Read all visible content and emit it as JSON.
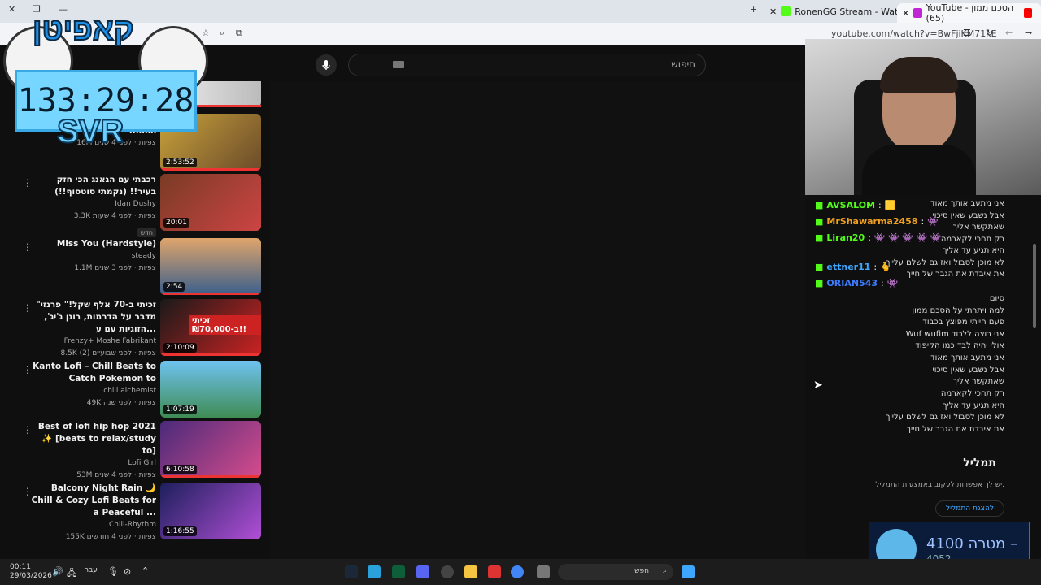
{
  "browser": {
    "tabs": [
      {
        "label": "RonenGG Stream - Watch Live",
        "color": "#53fc18"
      },
      {
        "label": "YouTube - הסכם ממון (65)",
        "color": "#ff0000"
      }
    ],
    "url": "youtube.com/watch?v=BwFjiKM71kE"
  },
  "youtube": {
    "search_placeholder": "חיפוש"
  },
  "overlay": {
    "logo": "קאפיטן",
    "timer": "133:29:28",
    "tag": "SVR"
  },
  "sidebar": {
    "items": [
      {
        "title": "",
        "channel": "",
        "meta": "16M צפיות · לפני 4 שנים",
        "duration": "2:53:52",
        "colors": [
          "#c8a33b",
          "#6b4a2a"
        ],
        "partial_title": "...mix"
      },
      {
        "title": "רכבתי עם הגאנג הכי חזק בעיר!! (נקמתי סוטסוף!!)",
        "channel": "Idan Dushy",
        "meta": "3.3K צפיות · לפני 4 שעות",
        "badge": "חדש",
        "duration": "20:01",
        "colors": [
          "#7a3b24",
          "#c44"
        ]
      },
      {
        "title": "Miss You (Hardstyle)",
        "channel": "steady",
        "meta": "1.1M צפיות · לפני 3 שנים",
        "duration": "2:54",
        "colors": [
          "#e0a56b",
          "#3a5f8c"
        ]
      },
      {
        "title": "\"זכיתי ב-70 אלף שקל!\" פרנזי מדבר על הדרמות, רונן ג'יג', הזוגיות עם ע...",
        "channel": "Frenzy+ Moshe Fabrikant",
        "meta": "8.5K צפיות · לפני שבועיים (2)",
        "duration": "2:10:09",
        "thumb_text": "זכיתי ב-₪70,000!!",
        "colors": [
          "#1a1a1a",
          "#c22"
        ]
      },
      {
        "title": "Kanto Lofi – Chill Beats to Catch Pokemon to",
        "channel": "chill alchemist",
        "meta": "49K צפיות · לפני שנה",
        "duration": "1:07:19",
        "colors": [
          "#6ec2ef",
          "#3f8c54"
        ]
      },
      {
        "title": "Best of lofi hip hop 2021 ✨ [beats to relax/study to]",
        "channel": "Lofi Girl",
        "meta": "53M צפיות · לפני 4 שנים",
        "duration": "6:10:58",
        "colors": [
          "#4a2a7a",
          "#d64c8c"
        ]
      },
      {
        "title": "Balcony Night Rain 🌙 Chill & Cozy Lofi Beats for a Peaceful ...",
        "channel": "Chill-Rhythm",
        "meta": "155K צפיות · לפני 4 חודשים",
        "duration": "1:16:55",
        "colors": [
          "#1d1f5c",
          "#b14fd6"
        ]
      }
    ]
  },
  "chat": {
    "messages": [
      {
        "user": "AVSALOM",
        "color": "#53fc18"
      },
      {
        "user": "MrShawarma2458",
        "color": "#f0a020"
      },
      {
        "user": "Liran20",
        "color": "#53fc18"
      },
      {
        "user": "ettner11",
        "color": "#3ea6ff"
      },
      {
        "user": "ORIAN543",
        "color": "#3e7cff"
      }
    ],
    "lyrics_top": [
      "אני מתעב אותך מאוד",
      "אבל נשבע שאין סיכוי",
      "שאתקשר אליך",
      "רק תחכי לקארמה",
      "היא תגיע עד אליך",
      "לא מוכן לסבול ואז גם לשלם עלייך",
      "את איבדת את הגבר של חייך"
    ],
    "lyrics": [
      "סיום",
      "למה ויתרתי על הסכם ממון",
      "פעם הייתי מפוצץ בכבוד",
      "Wuf wufim אני רוצה ללכוד",
      "אולי יהיה לבד כמו הקיפוד",
      "אני מתעב אותך מאוד",
      "אבל נשבע שאין סיכוי",
      "שאתקשר אליך",
      "רק תחכי לקארמה",
      "היא תגיע עד אליך",
      "לא מוכן לסבול ואז גם לשלם עלייך",
      "את איבדת את הגבר של חייך"
    ]
  },
  "playlist": {
    "title": "תמליל",
    "desc": "יש לך אפשרות לעקוב באמצעות התמליל.",
    "button": "להצגת התמליל"
  },
  "goal": {
    "label": "מטרה –",
    "target": "4100",
    "current": "4052"
  },
  "taskbar": {
    "time": "00:11",
    "date": "29/03/2026",
    "lang": "עבר",
    "search": "חפש"
  }
}
